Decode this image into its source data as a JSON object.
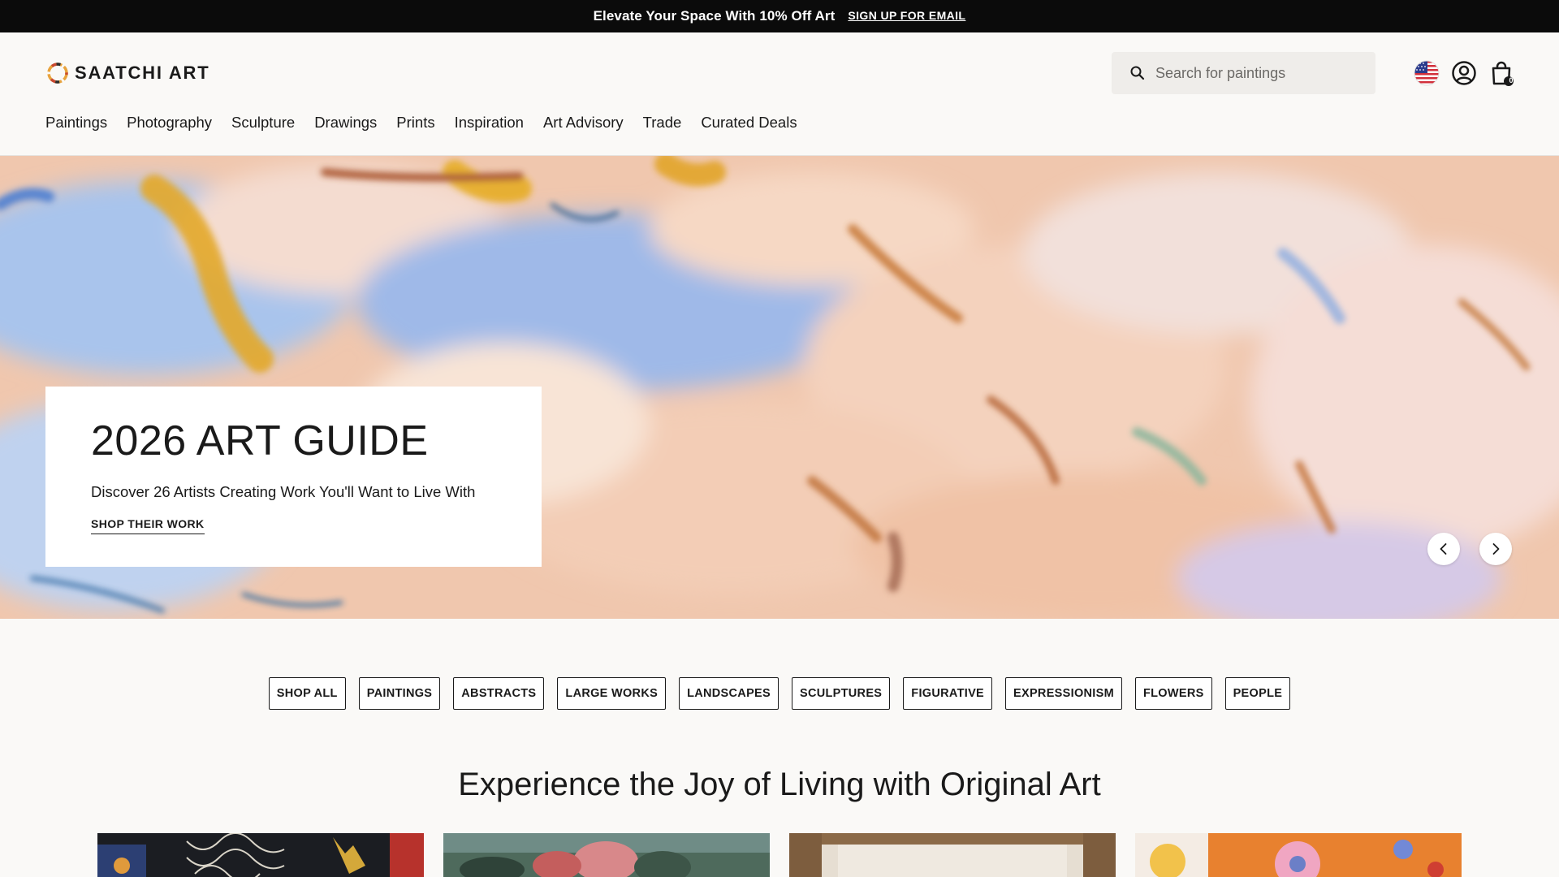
{
  "promo": {
    "text": "Elevate Your Space With 10% Off Art",
    "link_label": "SIGN UP FOR EMAIL"
  },
  "header": {
    "logo_text": "SAATCHI ART",
    "search": {
      "placeholder": "Search for paintings",
      "value": ""
    },
    "cart_count": "0",
    "icons": [
      "search-icon",
      "us-flag-icon",
      "account-icon",
      "cart-icon"
    ]
  },
  "nav": {
    "items": [
      {
        "label": "Paintings"
      },
      {
        "label": "Photography"
      },
      {
        "label": "Sculpture"
      },
      {
        "label": "Drawings"
      },
      {
        "label": "Prints"
      },
      {
        "label": "Inspiration"
      },
      {
        "label": "Art Advisory"
      },
      {
        "label": "Trade"
      },
      {
        "label": "Curated Deals"
      }
    ]
  },
  "hero": {
    "title": "2026 ART GUIDE",
    "subtitle": "Discover 26 Artists Creating Work You'll Want to Live With",
    "cta": "SHOP THEIR WORK"
  },
  "categories": {
    "chips": [
      {
        "label": "SHOP ALL"
      },
      {
        "label": "PAINTINGS"
      },
      {
        "label": "ABSTRACTS"
      },
      {
        "label": "LARGE WORKS"
      },
      {
        "label": "LANDSCAPES"
      },
      {
        "label": "SCULPTURES"
      },
      {
        "label": "FIGURATIVE"
      },
      {
        "label": "EXPRESSIONISM"
      },
      {
        "label": "FLOWERS"
      },
      {
        "label": "PEOPLE"
      }
    ]
  },
  "section": {
    "title": "Experience the Joy of Living with Original Art"
  },
  "colors": {
    "promo_bg": "#0b0b0b",
    "page_bg": "#faf9f7",
    "text": "#1a1a1a",
    "search_bg": "#efedea"
  }
}
